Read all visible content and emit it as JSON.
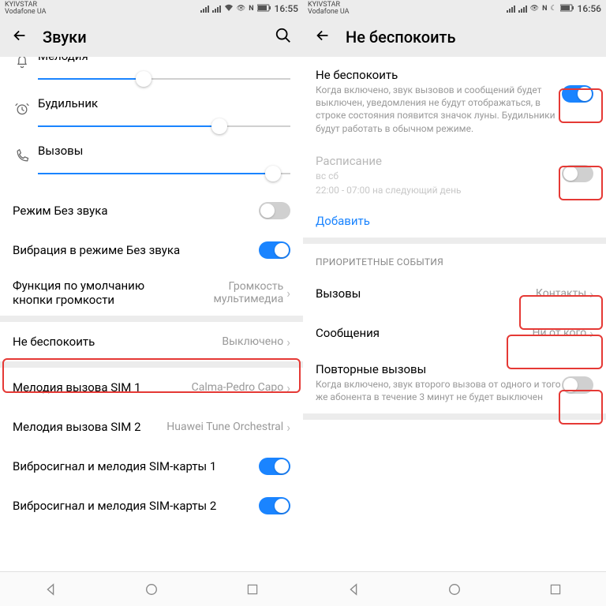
{
  "left": {
    "status": {
      "carrier1": "KYIVSTAR",
      "carrier2": "Vodafone UA",
      "time": "16:55"
    },
    "appbar": {
      "title": "Звуки"
    },
    "sliders": {
      "melody_label": "Мелодия",
      "alarm_label": "Будильник",
      "calls_label": "Вызовы",
      "melody_pct": 42,
      "alarm_pct": 72,
      "calls_pct": 93
    },
    "rows": {
      "silent_mode": "Режим Без звука",
      "vibrate_silent": "Вибрация в режиме Без звука",
      "vol_fn_title": "Функция по умолчанию кнопки громкости",
      "vol_fn_value": "Громкость мультимедиа",
      "dnd_title": "Не беспокоить",
      "dnd_value": "Выключено",
      "sim1_title": "Мелодия вызова SIM 1",
      "sim1_value": "Calma-Pedro Capo",
      "sim2_title": "Мелодия вызова SIM 2",
      "sim2_value": "Huawei Tune Orchestral",
      "vibro_sim1": "Вибросигнал и мелодия SIM-карты 1",
      "vibro_sim2": "Вибросигнал и мелодия SIM-карты 2"
    }
  },
  "right": {
    "status": {
      "carrier1": "KYIVSTAR",
      "carrier2": "Vodafone UA",
      "time": "16:56"
    },
    "appbar": {
      "title": "Не беспокоить"
    },
    "dnd": {
      "title": "Не беспокоить",
      "desc": "Когда включено, звук вызовов и сообщений будет выключен, уведомления не будут отображаться, в строке состояния появится значок луны. Будильники будут работать в обычном режиме."
    },
    "schedule": {
      "title": "Расписание",
      "days": "вс сб",
      "time": "22:00 - 07:00 на следующий день"
    },
    "add": "Добавить",
    "section": "ПРИОРИТЕТНЫЕ СОБЫТИЯ",
    "calls": {
      "title": "Вызовы",
      "value": "Контакты"
    },
    "messages": {
      "title": "Сообщения",
      "value": "Ни от кого"
    },
    "repeat": {
      "title": "Повторные вызовы",
      "desc": "Когда включено, звук второго вызова от одного и того же абонента в течение 3 минут не будет выключен"
    }
  }
}
